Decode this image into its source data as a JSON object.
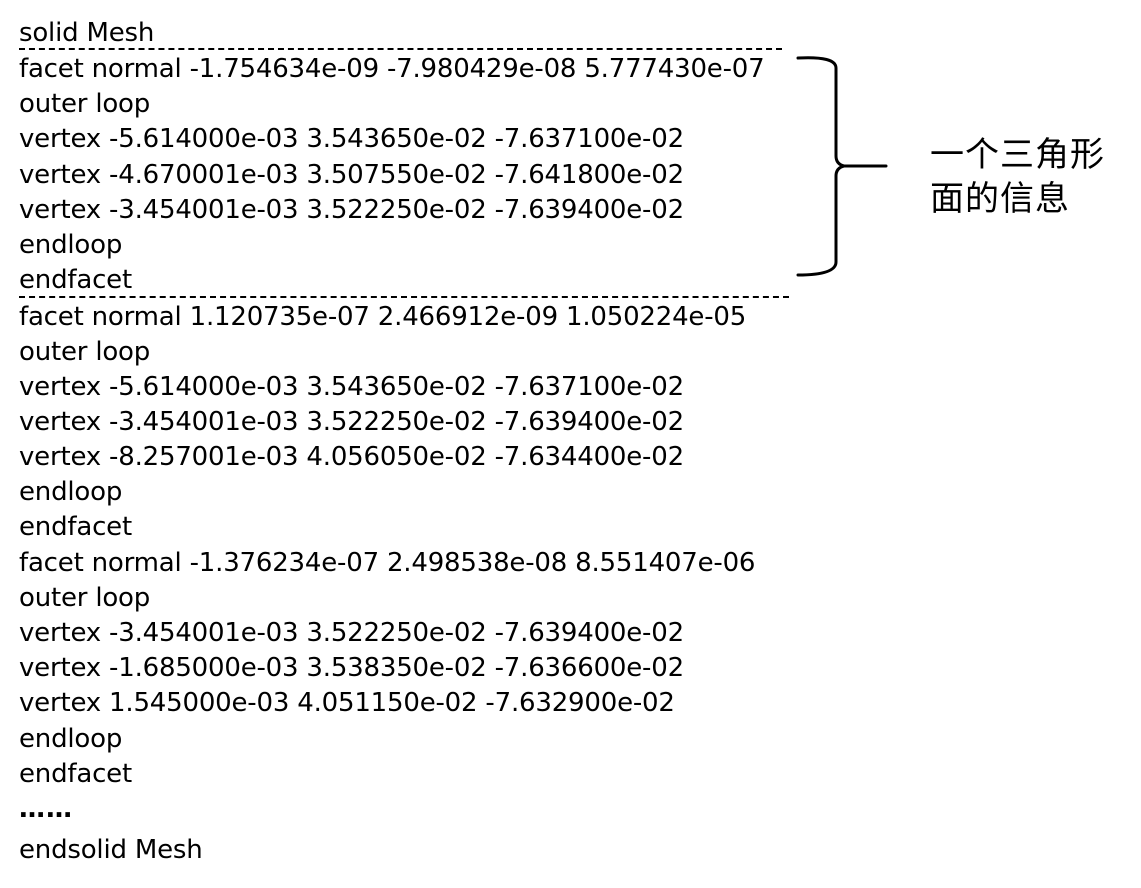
{
  "document": {
    "lines": [
      "solid Mesh",
      "facet normal -1.754634e-09 -7.980429e-08 5.777430e-07",
      "outer loop",
      "vertex -5.614000e-03 3.543650e-02 -7.637100e-02",
      "vertex -4.670001e-03 3.507550e-02 -7.641800e-02",
      "vertex -3.454001e-03 3.522250e-02 -7.639400e-02",
      "endloop",
      "endfacet",
      "facet normal 1.120735e-07 2.466912e-09 1.050224e-05",
      "outer loop",
      "vertex -5.614000e-03 3.543650e-02 -7.637100e-02",
      "vertex -3.454001e-03 3.522250e-02 -7.639400e-02",
      "vertex -8.257001e-03 4.056050e-02 -7.634400e-02",
      "endloop",
      "endfacet",
      "facet normal -1.376234e-07 2.498538e-08 8.551407e-06",
      "outer loop",
      "vertex -3.454001e-03 3.522250e-02 -7.639400e-02",
      "vertex -1.685000e-03 3.538350e-02 -7.636600e-02",
      "vertex 1.545000e-03 4.051150e-02 -7.632900e-02",
      "endloop",
      "endfacet",
      "……",
      "endsolid Mesh"
    ],
    "annotation": {
      "line1": "一个三角形",
      "line2": "面的信息"
    }
  }
}
